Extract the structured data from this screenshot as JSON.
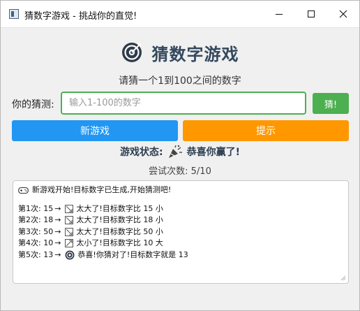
{
  "window": {
    "title": "猜数字游戏 - 挑战你的直觉!"
  },
  "header": {
    "title": "猜数字游戏"
  },
  "instruction": "请猜一个1到100之间的数字",
  "guess": {
    "label": "你的猜测:",
    "placeholder": "输入1-100的数字",
    "value": "",
    "button": "猜!"
  },
  "buttons": {
    "new_game": "新游戏",
    "hint": "提示"
  },
  "status": {
    "label": "游戏状态:",
    "message": "恭喜你赢了!"
  },
  "attempts": "尝试次数: 5/10",
  "log": {
    "start": "新游戏开始!目标数字已生成,开始猜测吧!",
    "entries": [
      {
        "prefix": "第1次: 15",
        "text": "太大了!目标数字比 15 小",
        "icon": "too-big-icon"
      },
      {
        "prefix": "第2次: 18",
        "text": "太大了!目标数字比 18 小",
        "icon": "too-big-icon"
      },
      {
        "prefix": "第3次: 50",
        "text": "太大了!目标数字比 50 小",
        "icon": "too-big-icon"
      },
      {
        "prefix": "第4次: 10",
        "text": "太小了!目标数字比 10 大",
        "icon": "too-small-icon"
      },
      {
        "prefix": "第5次: 13",
        "text": "恭喜!你猜对了!目标数字就是 13",
        "icon": "target-icon"
      }
    ],
    "arrow": "→"
  },
  "colors": {
    "accent_green": "#4caf50",
    "accent_blue": "#2196f3",
    "accent_orange": "#ff9800",
    "title_color": "#34495e"
  }
}
